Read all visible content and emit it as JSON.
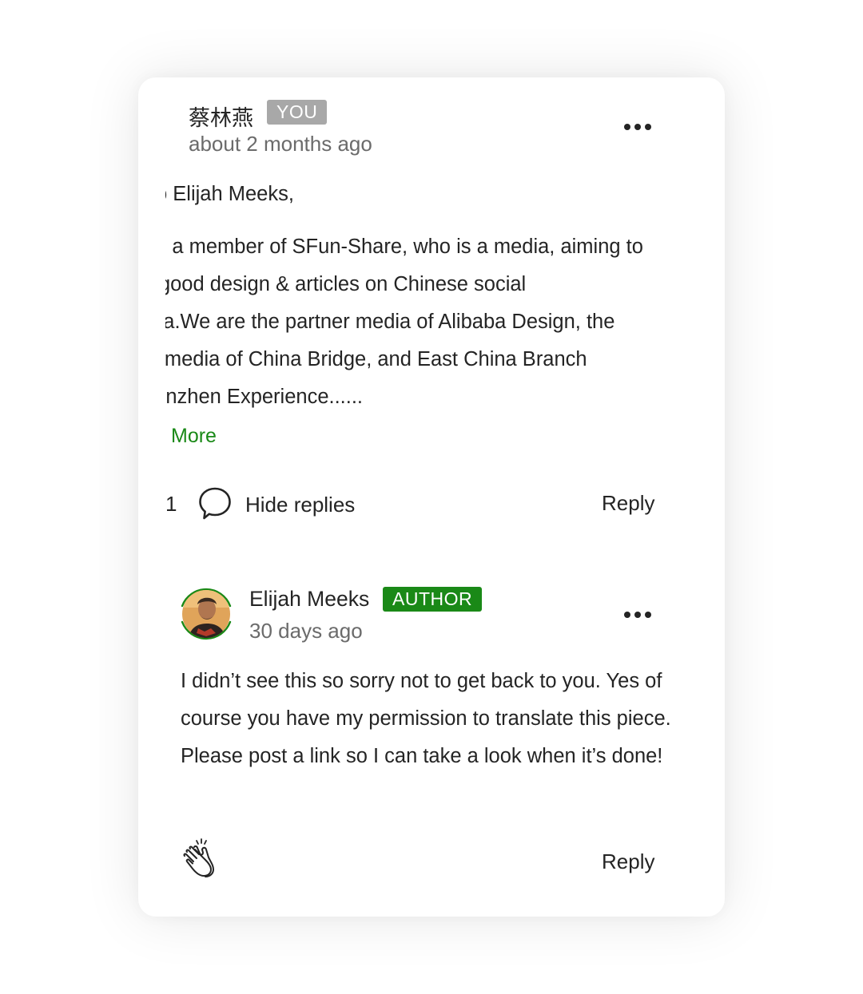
{
  "comment": {
    "username": "蔡林燕",
    "badge": "YOU",
    "time": "about 2 months ago",
    "body_lines": [
      "o Elijah Meeks,",
      "m a member of SFun-Share, who is a media, aiming to",
      "are good design & articles on Chinese social",
      "media.We are the partner media of Alibaba Design, the",
      "partner media of China Bridge,   and East China Branch",
      "Shenzhen Experience......"
    ],
    "more_label": "More",
    "reply_count": "1",
    "hide_replies_label": "Hide replies",
    "reply_label": "Reply"
  },
  "reply": {
    "username": "Elijah Meeks",
    "badge": "AUTHOR",
    "time": "30 days ago",
    "body": "I didn’t see this so sorry not to get back to you. Yes of course you have my permission to translate this piece. Please post a link so I can take a look when it’s done!",
    "reply_label": "Reply"
  },
  "colors": {
    "accent_green": "#1a8917",
    "you_badge_gray": "#a8a8a8",
    "text_primary": "#242424",
    "text_secondary": "#6b6b6b"
  },
  "icons": {
    "more": "more-horizontal-icon",
    "comment": "speech-bubble-icon",
    "clap": "clap-hands-icon"
  }
}
